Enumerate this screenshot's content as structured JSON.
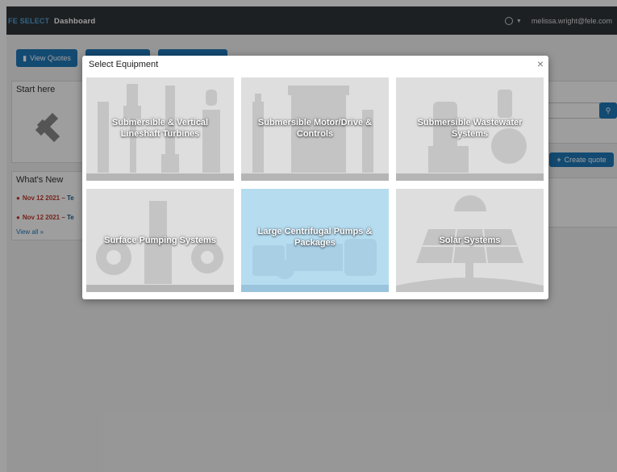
{
  "header": {
    "logo": "FE SELECT",
    "title": "Dashboard",
    "user_email": "melissa.wright@fele.com"
  },
  "toolbar": {
    "view_quotes_label": "View Quotes"
  },
  "start_panel": {
    "title": "Start here"
  },
  "news": {
    "title": "What's New",
    "items": [
      {
        "date": "Nov 12 2021",
        "text": "Te"
      },
      {
        "date": "Nov 12 2021",
        "text": "Te"
      }
    ],
    "view_all": "View all »"
  },
  "right": {
    "create_quote_label": "Create quote"
  },
  "modal": {
    "title": "Select Equipment",
    "close": "×",
    "tiles": [
      {
        "label": "Submersible & Vertical Lineshaft Turbines"
      },
      {
        "label": "Submersible Motor/Drive & Controls"
      },
      {
        "label": "Submersible Wastewater Systems"
      },
      {
        "label": "Surface Pumping Systems"
      },
      {
        "label": "Large Centrifugal Pumps & Packages"
      },
      {
        "label": "Solar Systems"
      }
    ]
  },
  "colors": {
    "topbar": "#2f3439",
    "accent": "#1f78b8",
    "tile_bg": "#dedede",
    "tile_active": "#b6dcf0",
    "news_red": "#c0392b"
  }
}
